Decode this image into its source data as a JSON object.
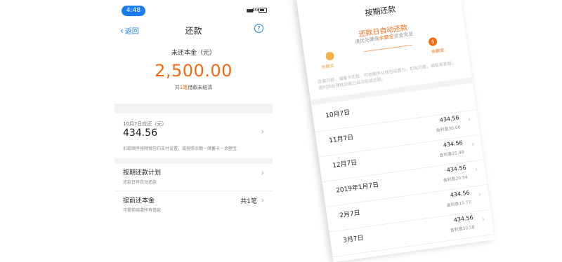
{
  "left": {
    "status": {
      "time": "4:48",
      "network": "4G"
    },
    "nav": {
      "back_label": "返回",
      "title": "还款",
      "help": "?"
    },
    "summary": {
      "label": "未还本金（元）",
      "amount": "2,500.00",
      "note_prefix": "共",
      "note_count": "1笔",
      "note_suffix": "借款未结清"
    },
    "due": {
      "label": "10月7日应还（元）",
      "amount": "434.56",
      "note": "扣款顺序按网钱包约支付设置，或按照余额－储蓄卡－余额宝"
    },
    "plan": {
      "title": "按期还款计划",
      "sub": "还款日将自动还款"
    },
    "prepay": {
      "title": "提前还本金",
      "sub": "可提前结清所有借款",
      "count": "共1笔"
    }
  },
  "right": {
    "status": {
      "network": "4G"
    },
    "title": "按期还款",
    "banner": {
      "title": "还款日自动还款",
      "sub_prefix": "请优先确保",
      "sub_highlight": "余额宝",
      "sub_suffix": "资金充足",
      "left_label": "余额宝",
      "right_label": "余额宝",
      "right_icon": "$"
    },
    "desc": "还款日前，储蓄卡还款，可按顺序从钱包设置为，如有问题，请联系客服，把时间处理就还款已自动完成还款。",
    "items": [
      {
        "date": "10月7日",
        "amount": "",
        "interest": ""
      },
      {
        "date": "11月7日",
        "amount": "434.56",
        "interest": "含利息30.00"
      },
      {
        "date": "12月7日",
        "amount": "434.56",
        "interest": "含利息25.98"
      },
      {
        "date": "2019年1月7日",
        "amount": "434.56",
        "interest": "含利息20.24"
      },
      {
        "date": "2月7日",
        "amount": "434.56",
        "interest": "含利息15.77"
      },
      {
        "date": "3月7日",
        "amount": "434.56",
        "interest": "含利息10.58"
      }
    ]
  },
  "colors": {
    "accent": "#1a7cf0",
    "highlight": "#f26a10"
  }
}
